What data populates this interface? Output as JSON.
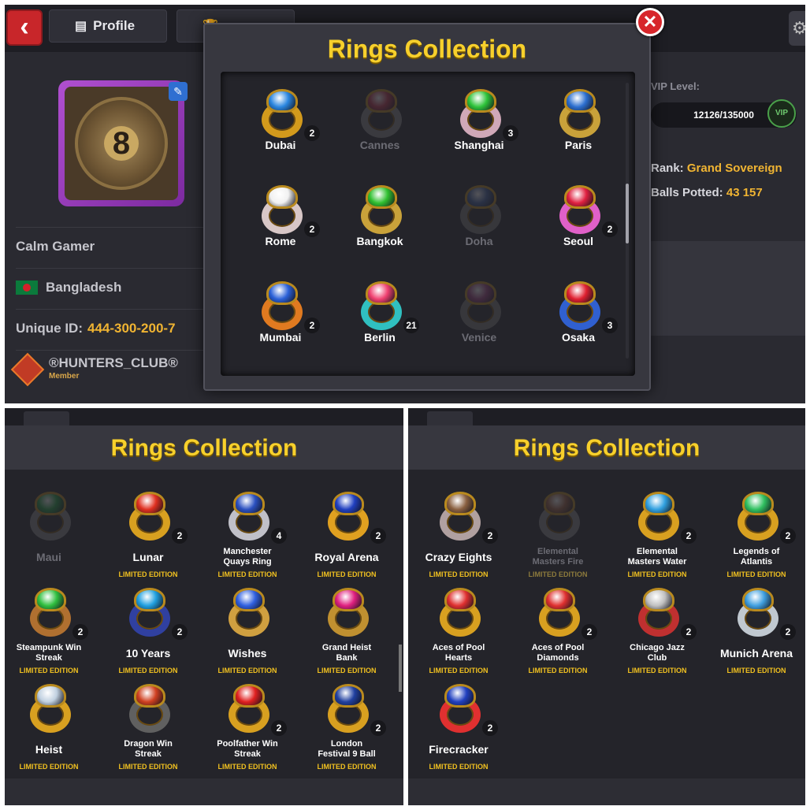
{
  "profile": {
    "tab_profile": "Profile",
    "player_name": "Calm Gamer",
    "country": "Bangladesh",
    "unique_id_label": "Unique ID:",
    "unique_id": "444-300-200-7",
    "club_name": "®HUNTERS_CLUB®",
    "club_role": "Member",
    "avatar_number": "8",
    "vip_level_label": "VIP Level:",
    "vip_progress": "12126/135000",
    "vip_badge": "VIP",
    "rank_label": "Rank:",
    "rank": "Grand Sovereign",
    "balls_potted_label": "Balls Potted:",
    "balls_potted": "43 157"
  },
  "modal": {
    "title": "Rings Collection",
    "close_icon": "close-icon"
  },
  "panel2": {
    "title": "Rings Collection"
  },
  "panel3": {
    "title": "Rings Collection"
  },
  "colors": {
    "title_gold": "#f7d02c",
    "limited_edition": "#f0c020",
    "close_red": "#d7262b",
    "avatar_frame": "#b04fd0"
  },
  "rings_page1": [
    {
      "name": "Dubai",
      "count": "2",
      "owned": true,
      "gem": "#2a86e0",
      "band": "#d39a1c"
    },
    {
      "name": "Cannes",
      "count": "",
      "owned": false,
      "gem": "#c0304a",
      "band": "#8a8a8a"
    },
    {
      "name": "Shanghai",
      "count": "3",
      "owned": true,
      "gem": "#2ec43a",
      "band": "#d0a8b8"
    },
    {
      "name": "Paris",
      "count": "",
      "owned": true,
      "gem": "#2c6fd0",
      "band": "#c9a23a"
    },
    {
      "name": "Rome",
      "count": "2",
      "owned": true,
      "gem": "#f1f1f1",
      "band": "#d8c7c7"
    },
    {
      "name": "Bangkok",
      "count": "",
      "owned": true,
      "gem": "#30c030",
      "band": "#c9a23a"
    },
    {
      "name": "Doha",
      "count": "",
      "owned": false,
      "gem": "#4060a0",
      "band": "#7a7a7a"
    },
    {
      "name": "Seoul",
      "count": "2",
      "owned": true,
      "gem": "#e02040",
      "band": "#e060c8"
    },
    {
      "name": "Mumbai",
      "count": "2",
      "owned": true,
      "gem": "#2a60d8",
      "band": "#e07a20"
    },
    {
      "name": "Berlin",
      "count": "21",
      "owned": true,
      "gem": "#f04070",
      "band": "#30c0c0"
    },
    {
      "name": "Venice",
      "count": "",
      "owned": false,
      "gem": "#a04080",
      "band": "#7a7a7a"
    },
    {
      "name": "Osaka",
      "count": "3",
      "owned": true,
      "gem": "#e02030",
      "band": "#3060d0"
    }
  ],
  "rings_page2": [
    {
      "name": "Maui",
      "count": "",
      "owned": false,
      "edition": "",
      "gem": "#20a040",
      "band": "#8a8a8a"
    },
    {
      "name": "Lunar",
      "count": "2",
      "owned": true,
      "edition": "LIMITED EDITION",
      "gem": "#e03020",
      "band": "#d8a020"
    },
    {
      "name": "Manchester Quays Ring",
      "count": "4",
      "owned": true,
      "edition": "LIMITED EDITION",
      "gem": "#2a50c0",
      "band": "#c0c0c8"
    },
    {
      "name": "Royal Arena",
      "count": "2",
      "owned": true,
      "edition": "LIMITED EDITION",
      "gem": "#2040c0",
      "band": "#e0a020"
    },
    {
      "name": "Steampunk Win Streak",
      "count": "2",
      "owned": true,
      "edition": "LIMITED EDITION",
      "gem": "#30c040",
      "band": "#b07030"
    },
    {
      "name": "10 Years",
      "count": "2",
      "owned": true,
      "edition": "LIMITED EDITION",
      "gem": "#20a0e0",
      "band": "#3040a0"
    },
    {
      "name": "Wishes",
      "count": "",
      "owned": true,
      "edition": "LIMITED EDITION",
      "gem": "#3060e0",
      "band": "#d0a040"
    },
    {
      "name": "Grand Heist Bank",
      "count": "",
      "owned": true,
      "edition": "LIMITED EDITION",
      "gem": "#e02080",
      "band": "#c09030"
    },
    {
      "name": "Heist",
      "count": "",
      "owned": true,
      "edition": "LIMITED EDITION",
      "gem": "#c0d0e0",
      "band": "#d8a020"
    },
    {
      "name": "Dragon Win Streak",
      "count": "",
      "owned": true,
      "edition": "LIMITED EDITION",
      "gem": "#d04020",
      "band": "#606060"
    },
    {
      "name": "Poolfather Win Streak",
      "count": "2",
      "owned": true,
      "edition": "LIMITED EDITION",
      "gem": "#e02020",
      "band": "#d8a020"
    },
    {
      "name": "London Festival 9 Ball",
      "count": "2",
      "owned": true,
      "edition": "LIMITED EDITION",
      "gem": "#2040a0",
      "band": "#d8a020"
    }
  ],
  "rings_page3": [
    {
      "name": "Crazy Eights",
      "count": "2",
      "owned": true,
      "edition": "LIMITED EDITION",
      "gem": "#8a6040",
      "band": "#b0a0a0"
    },
    {
      "name": "Elemental Masters Fire",
      "count": "",
      "owned": false,
      "edition": "LIMITED EDITION",
      "gem": "#a06040",
      "band": "#8a8a8a"
    },
    {
      "name": "Elemental Masters Water",
      "count": "2",
      "owned": true,
      "edition": "LIMITED EDITION",
      "gem": "#30a0e0",
      "band": "#d8a020"
    },
    {
      "name": "Legends of Atlantis",
      "count": "2",
      "owned": true,
      "edition": "LIMITED EDITION",
      "gem": "#30c060",
      "band": "#d8a020"
    },
    {
      "name": "Aces of Pool Hearts",
      "count": "",
      "owned": true,
      "edition": "LIMITED EDITION",
      "gem": "#e03030",
      "band": "#d8a020"
    },
    {
      "name": "Aces of Pool Diamonds",
      "count": "2",
      "owned": true,
      "edition": "LIMITED EDITION",
      "gem": "#e03030",
      "band": "#d8a020"
    },
    {
      "name": "Chicago Jazz Club",
      "count": "2",
      "owned": true,
      "edition": "LIMITED EDITION",
      "gem": "#c0c0c0",
      "band": "#c03030"
    },
    {
      "name": "Munich Arena",
      "count": "2",
      "owned": true,
      "edition": "LIMITED EDITION",
      "gem": "#40a0e0",
      "band": "#c0c8d0"
    },
    {
      "name": "Firecracker",
      "count": "2",
      "owned": true,
      "edition": "LIMITED EDITION",
      "gem": "#2040c0",
      "band": "#e03030"
    }
  ]
}
